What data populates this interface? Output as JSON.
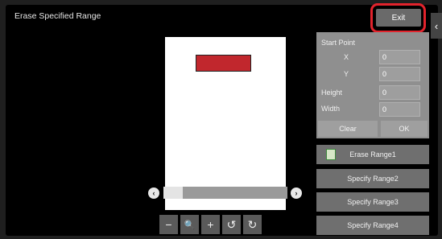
{
  "header": {
    "title": "Erase Specified Range",
    "exit_label": "Exit"
  },
  "panel": {
    "start_point_label": "Start Point",
    "x_label": "X",
    "x_value": "0",
    "y_label": "Y",
    "y_value": "0",
    "height_label": "Height",
    "height_value": "0",
    "width_label": "Width",
    "width_value": "0",
    "clear_label": "Clear",
    "ok_label": "OK"
  },
  "ranges": [
    {
      "label": "Erase Range1"
    },
    {
      "label": "Specify Range2"
    },
    {
      "label": "Specify Range3"
    },
    {
      "label": "Specify Range4"
    }
  ],
  "scroll": {
    "left_glyph": "‹",
    "right_glyph": "›"
  },
  "toolbar": {
    "zoom_out": "−",
    "zoom": "🔍",
    "zoom_in": "+",
    "rotate_left": "↺",
    "rotate_right": "↻"
  },
  "side_tab_glyph": "‹"
}
